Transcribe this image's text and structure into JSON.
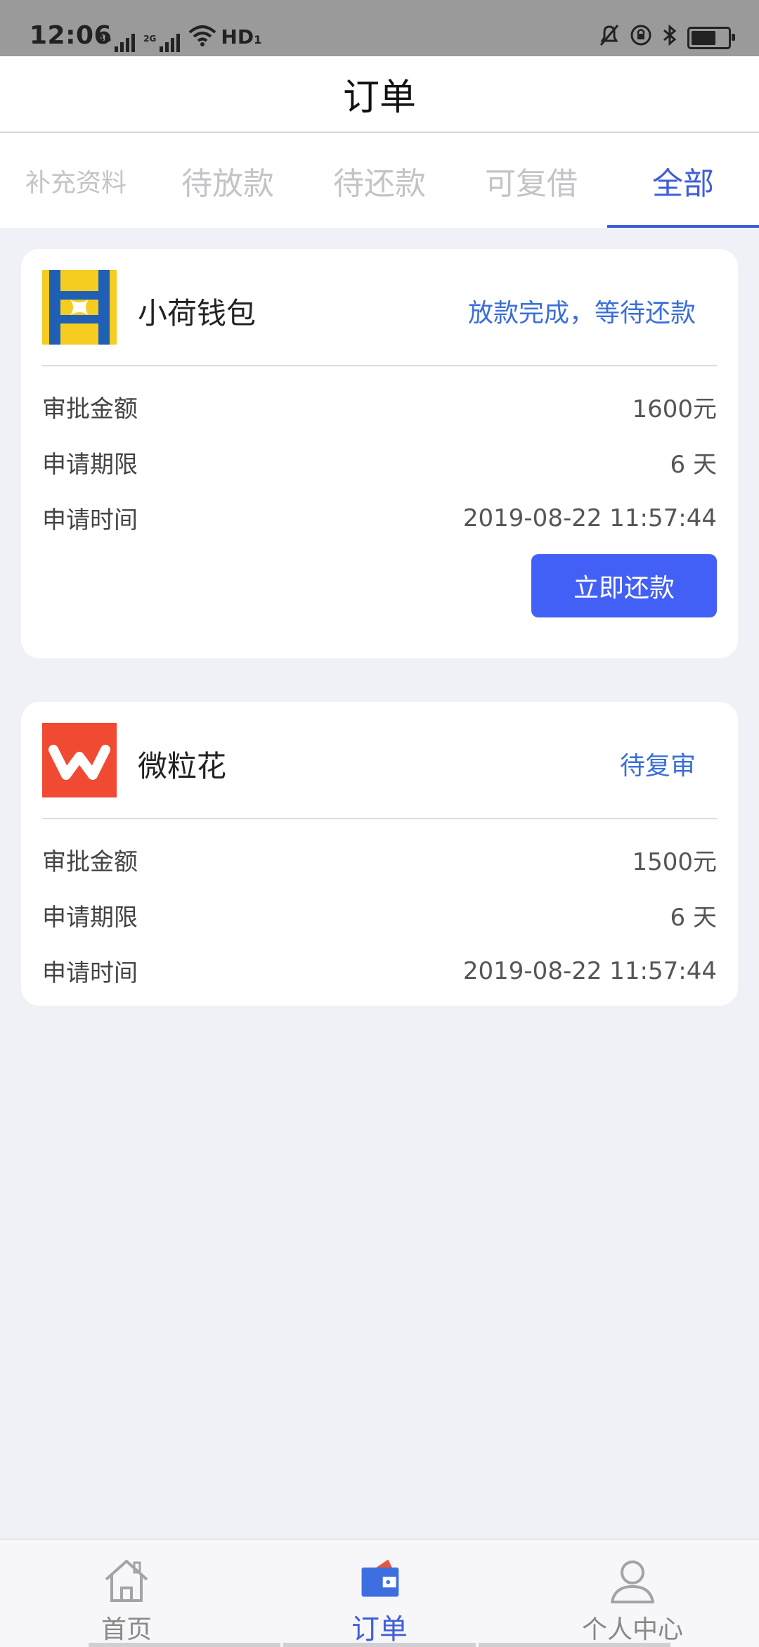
{
  "status_bar": {
    "time": "12:06",
    "signal1_label": "4G",
    "signal2_label": "2G",
    "hd_label": "HD",
    "hd_sub": "1"
  },
  "nav": {
    "title": "订单"
  },
  "tabs": [
    {
      "label": "补充资料",
      "active": false
    },
    {
      "label": "待放款",
      "active": false
    },
    {
      "label": "待还款",
      "active": false
    },
    {
      "label": "可复借",
      "active": false
    },
    {
      "label": "全部",
      "active": true
    }
  ],
  "orders": [
    {
      "name": "小荷钱包",
      "status": "放款完成，等待还款",
      "rows": [
        {
          "label": "审批金额",
          "value": "1600元"
        },
        {
          "label": "申请期限",
          "value": "6 天"
        },
        {
          "label": "申请时间",
          "value": "2019-08-22 11:57:44"
        }
      ],
      "action_label": "立即还款"
    },
    {
      "name": "微粒花",
      "status": "待复审",
      "rows": [
        {
          "label": "审批金额",
          "value": "1500元"
        },
        {
          "label": "申请期限",
          "value": "6 天"
        },
        {
          "label": "申请时间",
          "value": "2019-08-22 11:57:44"
        }
      ]
    }
  ],
  "bottom_nav": [
    {
      "label": "首页",
      "icon": "home-icon",
      "active": false
    },
    {
      "label": "订单",
      "icon": "wallet-icon",
      "active": true
    },
    {
      "label": "个人中心",
      "icon": "person-icon",
      "active": false
    }
  ],
  "colors": {
    "accent": "#3f5ed8",
    "button": "#4260f5",
    "status_text": "#3a6fd8",
    "background": "#f0f1f6"
  }
}
